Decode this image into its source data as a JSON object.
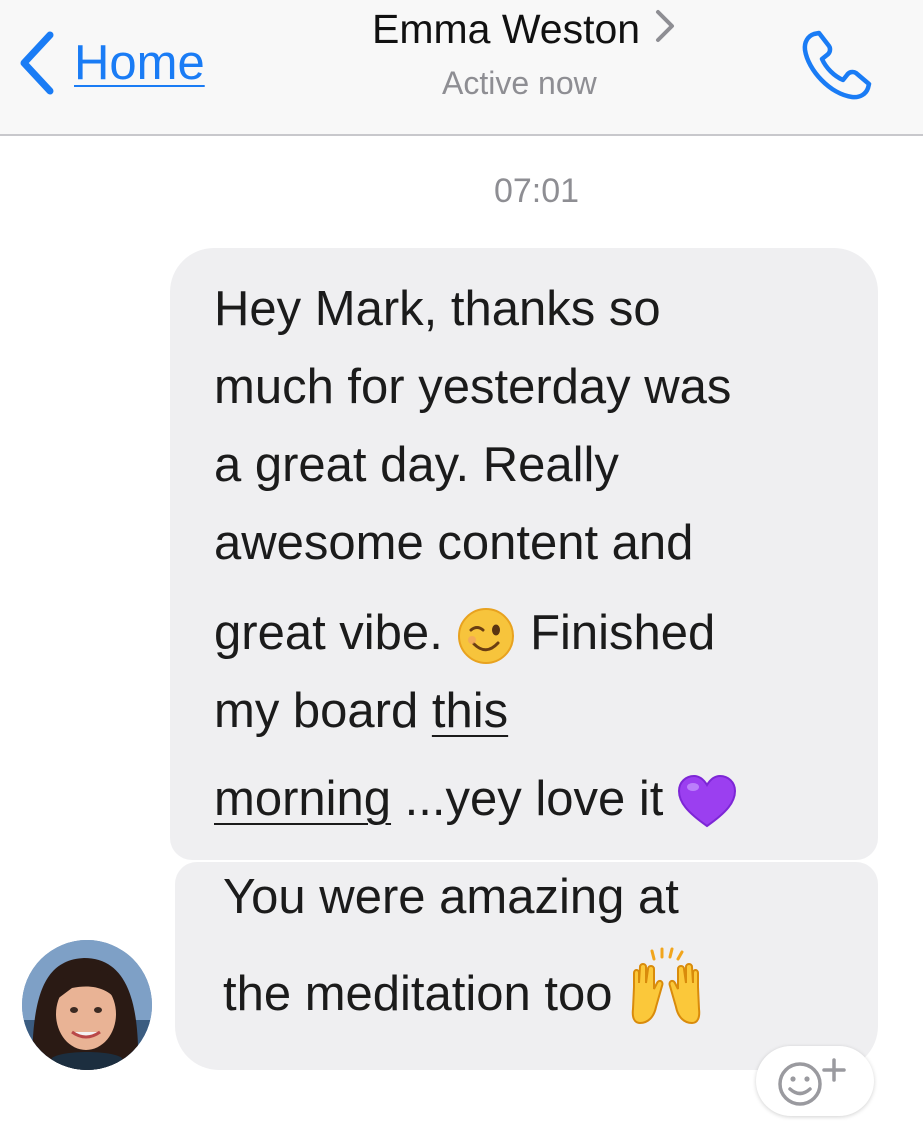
{
  "header": {
    "back_label": "Home",
    "contact_name": "Emma Weston",
    "status": "Active now",
    "accent_color": "#1a7cf5",
    "back_icon": "chevron-left-icon",
    "detail_icon": "chevron-right-icon",
    "call_icon": "phone-icon"
  },
  "conversation": {
    "timestamp": "07:01",
    "messages": [
      {
        "sender": "Emma Weston",
        "lines": [
          "Hey Mark, thanks so",
          "much for yesterday was",
          "a great day. Really",
          "awesome content and",
          "great vibe.",
          "Finished",
          "my board ",
          "this",
          "morning",
          " ...yey love it"
        ],
        "link_text": "this morning",
        "emojis": [
          "winking-face-icon",
          "purple-heart-icon"
        ]
      },
      {
        "sender": "Emma Weston",
        "lines": [
          "You were amazing at",
          "the meditation too"
        ],
        "emojis": [
          "raising-hands-icon"
        ]
      }
    ]
  },
  "composer": {
    "reaction_icon": "add-reaction-icon"
  }
}
